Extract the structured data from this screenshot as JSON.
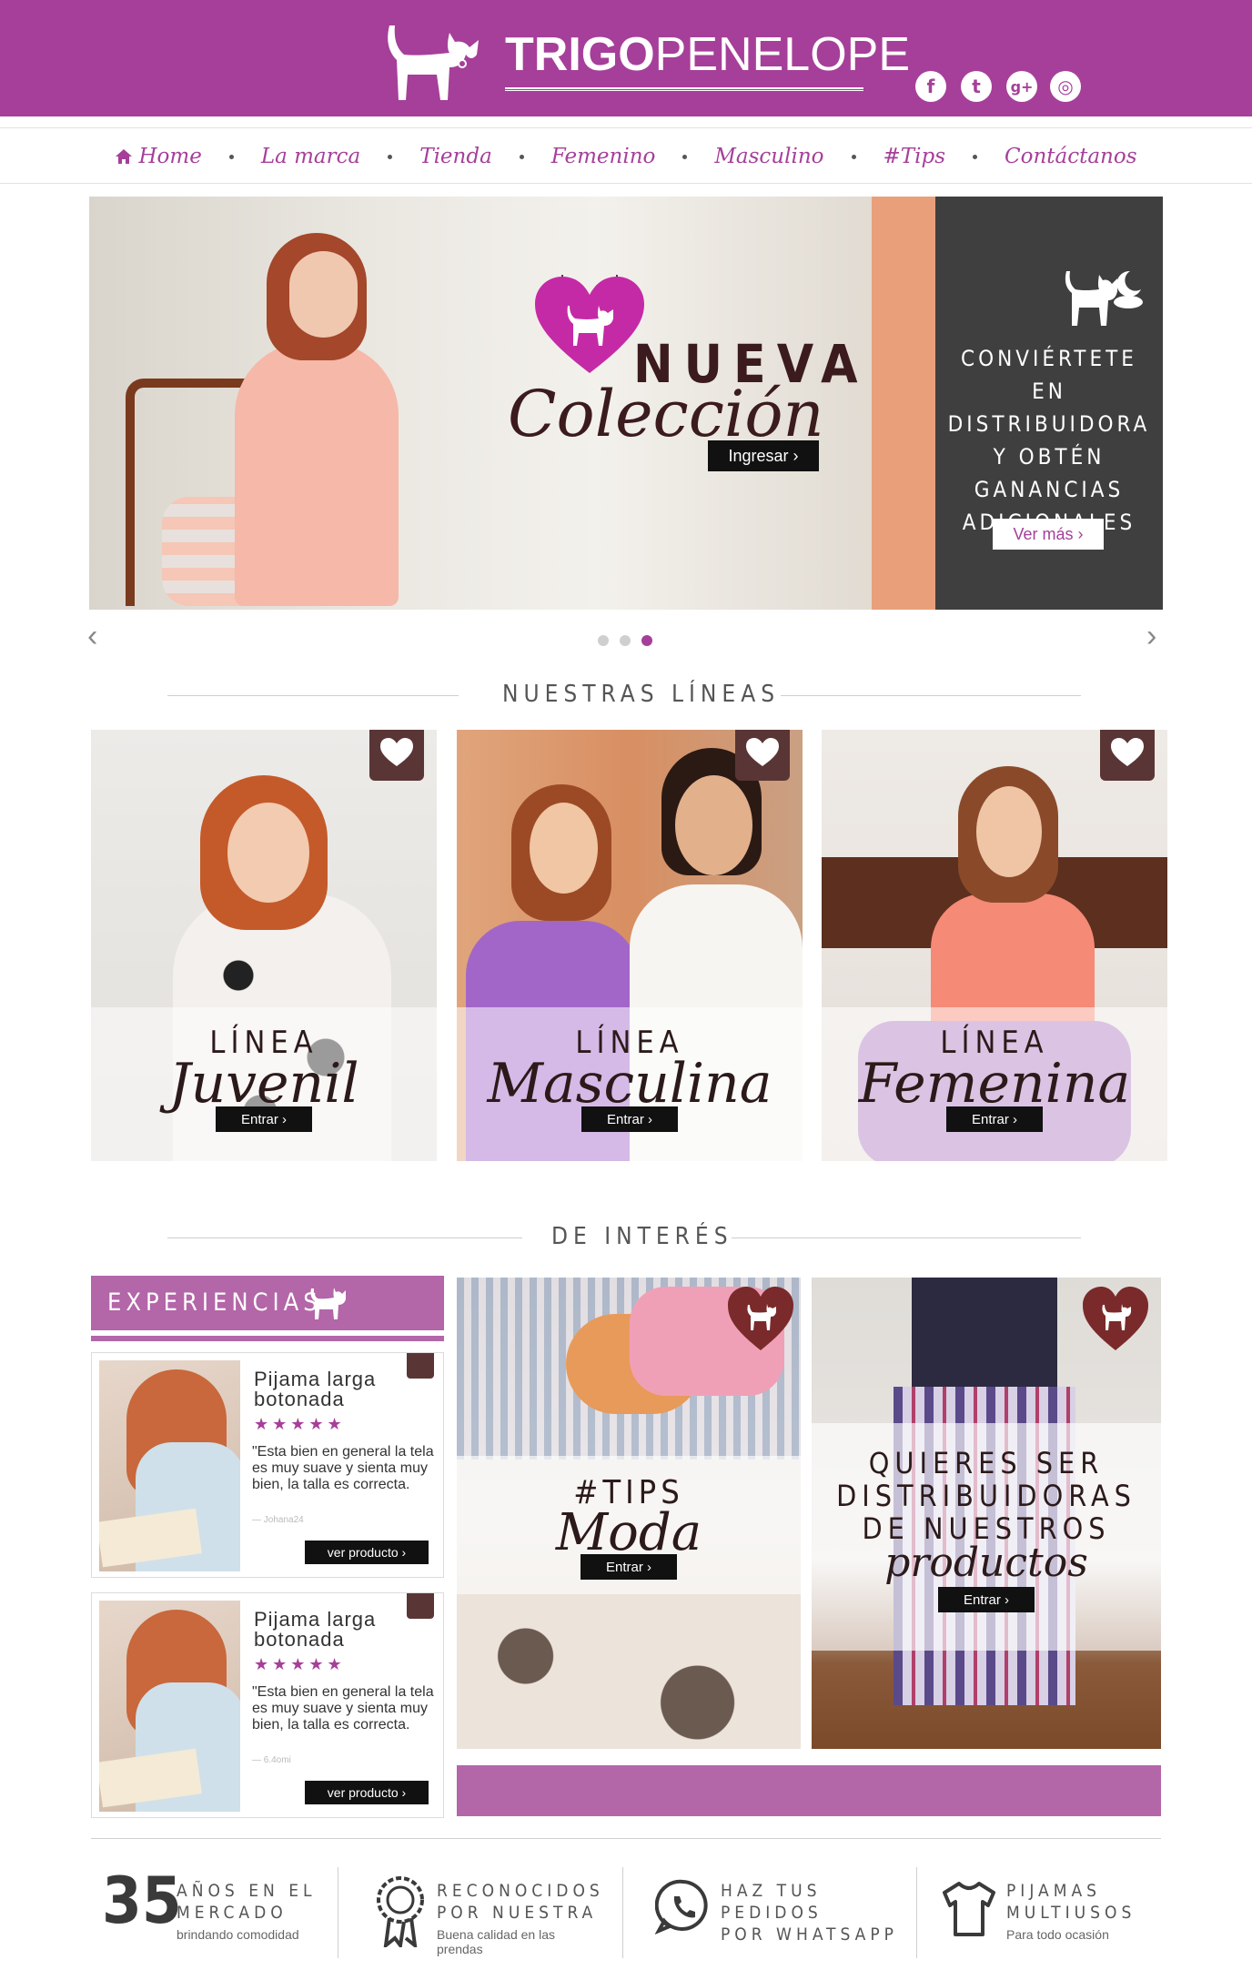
{
  "header": {
    "brand_bold": "TRIGO",
    "brand_light": "PENELOPE",
    "social": [
      {
        "icon": "facebook-icon",
        "glyph": "f"
      },
      {
        "icon": "twitter-icon",
        "glyph": "t"
      },
      {
        "icon": "google-plus-icon",
        "glyph": "g+"
      },
      {
        "icon": "instagram-icon",
        "glyph": "◎"
      }
    ],
    "colors": {
      "primary": "#a63f99",
      "secondary": "#b366a8",
      "tag": "#5a3535"
    }
  },
  "nav": {
    "items": [
      "Home",
      "La marca",
      "Tienda",
      "Femenino",
      "Masculino",
      "#Tips",
      "Contáctanos"
    ]
  },
  "hero": {
    "nueva": "NUEVA",
    "coleccion": "Colección",
    "button": "Ingresar",
    "distributor_text": "CONVIÉRTETE EN\nDISTRIBUIDORA\nY OBTÉN\nGANANCIAS\nADICIONALES",
    "distributor_button": "Ver más",
    "active_slide": 3,
    "slides_total": 3
  },
  "lineas": {
    "title": "NUESTRAS LÍNEAS",
    "cards": [
      {
        "linea": "LÍNEA",
        "name": "Juvenil",
        "button": "Entrar"
      },
      {
        "linea": "LÍNEA",
        "name": "Masculina",
        "button": "Entrar"
      },
      {
        "linea": "LÍNEA",
        "name": "Femenina",
        "button": "Entrar"
      }
    ]
  },
  "interes": {
    "title": "DE INTERÉS",
    "experiencias": {
      "title": "EXPERIENCIAS",
      "items": [
        {
          "title": "Pijama larga\nbotonada",
          "stars": "★★★★★",
          "quote": "\"Esta bien en general la tela es muy suave y sienta muy bien, la talla es correcta.",
          "author": "— Johana24",
          "button": "ver producto"
        },
        {
          "title": "Pijama larga\nbotonada",
          "stars": "★★★★★",
          "quote": "\"Esta bien en general la tela es muy suave y sienta muy bien, la talla es correcta.",
          "author": "— 6.4omi",
          "button": "ver producto"
        }
      ]
    },
    "tips": {
      "title": "#TIPS",
      "script": "Moda",
      "button": "Entrar"
    },
    "distribuidoras": {
      "title": "QUIERES SER\nDISTRIBUIDORAS\nDE NUESTROS",
      "script": "productos",
      "button": "Entrar"
    }
  },
  "footer": {
    "features": [
      {
        "number": "35",
        "title": "AÑOS EN EL\nMERCADO",
        "sub": "brindando comodidad"
      },
      {
        "icon": "award-icon",
        "title": "RECONOCIDOS\nPOR NUESTRA",
        "sub": "Buena calidad en las prendas"
      },
      {
        "icon": "whatsapp-icon",
        "title": "HAZ TUS PEDIDOS\nPOR WHATSAPP",
        "sub": ""
      },
      {
        "icon": "shirt-icon",
        "title": "PIJAMAS\nMULTIUSOS",
        "sub": "Para todo ocasión"
      }
    ]
  }
}
